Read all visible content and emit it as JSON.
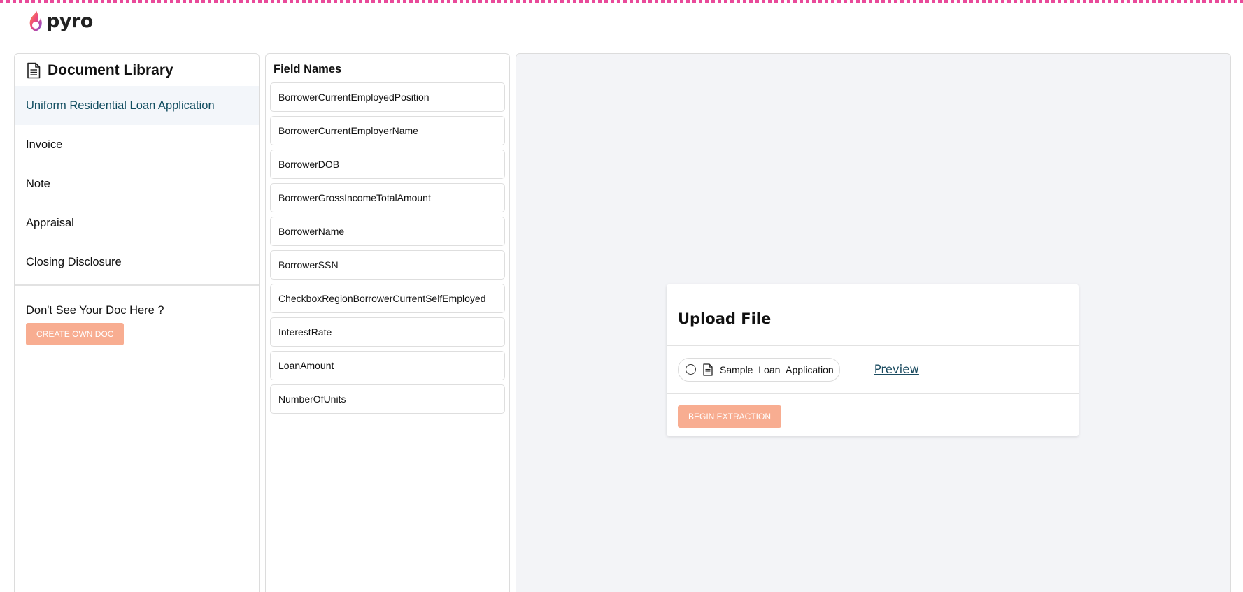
{
  "app": {
    "logo_text": "pyro"
  },
  "document_library": {
    "title": "Document Library",
    "items": [
      {
        "label": "Uniform Residential Loan Application",
        "active": true
      },
      {
        "label": "Invoice",
        "active": false
      },
      {
        "label": "Note",
        "active": false
      },
      {
        "label": "Appraisal",
        "active": false
      },
      {
        "label": "Closing Disclosure",
        "active": false
      }
    ],
    "cta_text": "Don't See Your Doc Here ?",
    "create_button_label": "CREATE OWN DOC"
  },
  "field_names": {
    "title": "Field Names",
    "items": [
      "BorrowerCurrentEmployedPosition",
      "BorrowerCurrentEmployerName",
      "BorrowerDOB",
      "BorrowerGrossIncomeTotalAmount",
      "BorrowerName",
      "BorrowerSSN",
      "CheckboxRegionBorrowerCurrentSelfEmployed",
      "InterestRate",
      "LoanAmount",
      "NumberOfUnits"
    ]
  },
  "upload": {
    "title": "Upload File",
    "file_name": "Sample_Loan_Application",
    "preview_label": "Preview",
    "extract_button_label": "BEGIN EXTRACTION"
  },
  "colors": {
    "accent_button": "#f8ad91",
    "active_item_text": "#114d60",
    "active_item_bg": "#f3f6fa",
    "link": "#1b4b60",
    "viewer_bg": "#f3f4f7"
  },
  "icons": {
    "logo": "flame-icon",
    "document": "document-icon",
    "radio": "radio-unselected-icon"
  }
}
